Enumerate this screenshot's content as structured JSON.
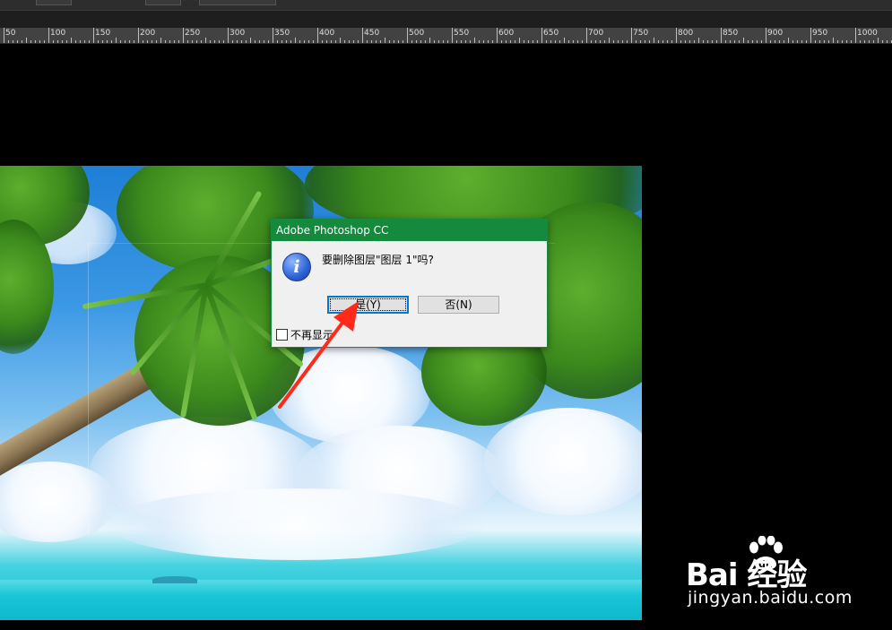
{
  "ruler": {
    "labels": [
      "50",
      "100",
      "150",
      "200",
      "250",
      "300",
      "350",
      "400",
      "450",
      "500",
      "550",
      "600",
      "650",
      "700",
      "750",
      "800",
      "850",
      "900",
      "950",
      "1000"
    ]
  },
  "dialog": {
    "title": "Adobe Photoshop CC",
    "message": "要删除图层\"图层 1\"吗?",
    "yes_label": "是(Y)",
    "no_label": "否(N)",
    "dont_show_label": "不再显示",
    "icon": "info-icon"
  },
  "watermark": {
    "brand": "Bai  经验",
    "url": "jingyan.baidu.com"
  },
  "colors": {
    "dialog_title_bg": "#138a3c",
    "arrow": "#ff2a1a",
    "default_button_border": "#0078d7"
  }
}
